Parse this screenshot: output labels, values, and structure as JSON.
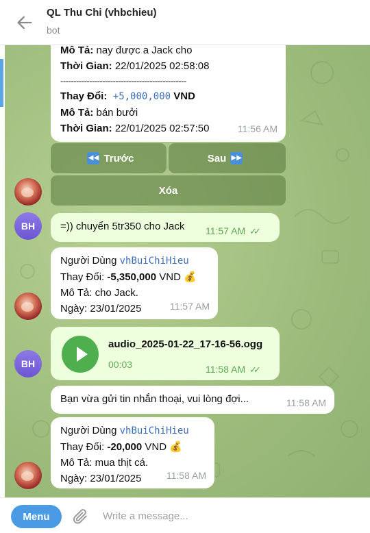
{
  "header": {
    "title": "QL Thu Chi (vhbchieu)",
    "subtitle": "bot",
    "back_icon": "arrow-left-icon"
  },
  "messages": {
    "m1": {
      "line1_label": "Mô Tả:",
      "line1_value": " nay được a Jack cho",
      "line2_label": "Thời Gian:",
      "line2_value": "  22/01/2025 02:58:08",
      "separator": "------------------------------------------------",
      "line3_label": "Thay Đổi:",
      "line3_amount": " +5,000,000",
      "line3_currency": " VND",
      "line4_label": "Mô Tả:",
      "line4_value": " bán bưởi",
      "line5_label": "Thời Gian:",
      "line5_value": "  22/01/2025 02:57:50",
      "time": "11:56 AM"
    },
    "keyboard": {
      "prev": "Trước",
      "next": "Sau",
      "delete": "Xóa"
    },
    "m2": {
      "text": "=)) chuyển 5tr350 cho Jack",
      "time": "11:57 AM",
      "avatar": "BH"
    },
    "m3": {
      "user_label": "Người Dùng ",
      "user_value": "vhBuiChiHieu",
      "change_label": "Thay Đổi: ",
      "change_value": "-5,350,000",
      "change_currency": " VND ",
      "money_icon": "💰",
      "desc_label": "Mô Tả: ",
      "desc_value": "cho Jack.",
      "date_label": "Ngày: ",
      "date_value": "23/01/2025",
      "time": "11:57 AM"
    },
    "m4": {
      "filename": "audio_2025-01-22_17-16-56.ogg",
      "duration": "00:03",
      "time": "11:58 AM",
      "avatar": "BH"
    },
    "m5": {
      "text": "Bạn vừa gửi tin nhắn thoại, vui lòng đợi...",
      "time": "11:58 AM"
    },
    "m6": {
      "user_label": "Người Dùng ",
      "user_value": "vhBuiChiHieu",
      "change_label": "Thay Đổi: ",
      "change_value": "-20,000",
      "change_currency": " VND ",
      "money_icon": "💰",
      "desc_label": "Mô Tả: ",
      "desc_value": "mua thịt cá.",
      "date_label": "Ngày: ",
      "date_value": "23/01/2025",
      "time": "11:58 AM"
    }
  },
  "composer": {
    "menu_label": "Menu",
    "placeholder": "Write a message..."
  },
  "colors": {
    "accent": "#4a9be3",
    "chat_bg": "#a9c586",
    "outgoing": "#eeffde",
    "time_outgoing": "#5ca853"
  }
}
